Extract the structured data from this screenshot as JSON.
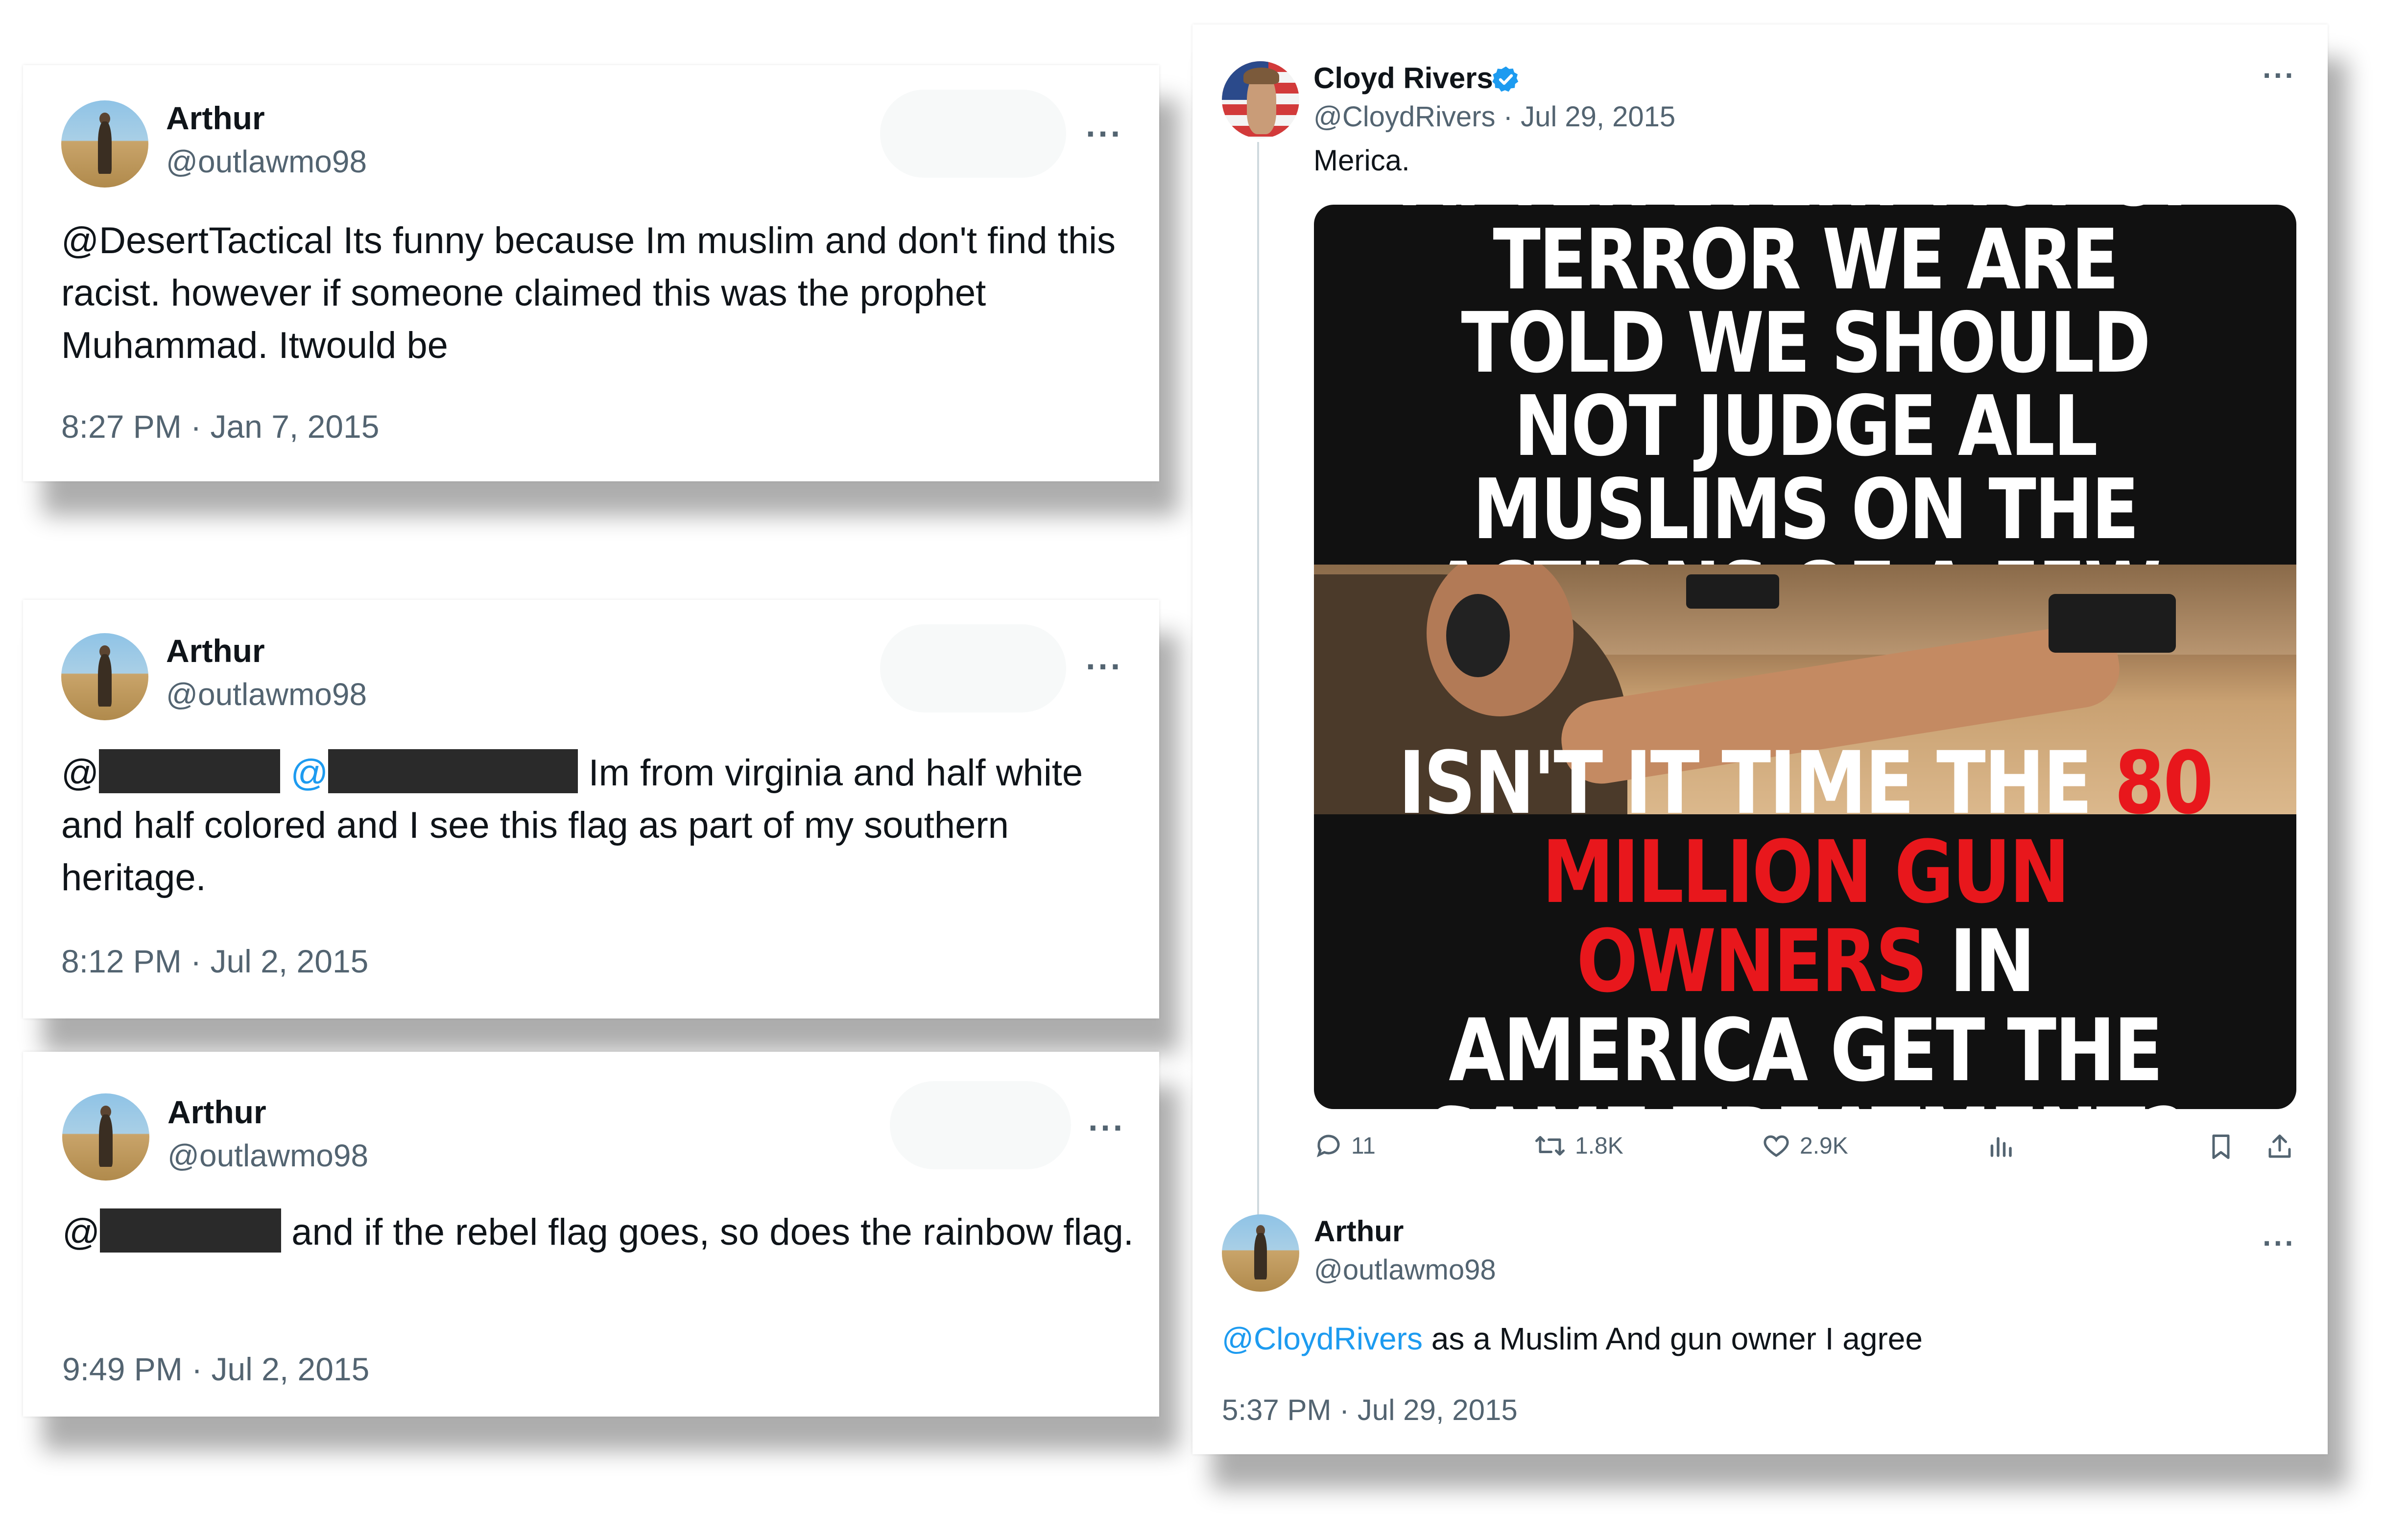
{
  "tweets": [
    {
      "name": "Arthur",
      "handle": "@outlawmo98",
      "text": "@DesertTactical Its funny because Im muslim and don't find this racist. however if someone claimed this was the prophet Muhammad. Itwould be",
      "time": "8:27 PM · Jan 7, 2015"
    },
    {
      "name": "Arthur",
      "handle": "@outlawmo98",
      "at1": "@",
      "at2": "@",
      "text": "Im from virginia and half white and half colored and I see this flag as part of my southern heritage.",
      "time": "8:12 PM · Jul 2, 2015"
    },
    {
      "name": "Arthur",
      "handle": "@outlawmo98",
      "at1": "@",
      "text": "and if the rebel flag goes, so does the rainbow flag.",
      "time": "9:49 PM · Jul 2, 2015"
    }
  ],
  "cloyd": {
    "name": "Cloyd Rivers",
    "handle": "@CloydRivers",
    "date": "· Jul 29, 2015",
    "text": "Merica.",
    "meme_top": "After every act of terror we are told we should not judge all Muslims on the actions of a few.",
    "meme_bottom_1": "Isn't it time the",
    "meme_bottom_red_1": "80 million",
    "meme_bottom_red_2": "gun owners",
    "meme_bottom_2": "in America get the same treatment?",
    "replies": "11",
    "retweets": "1.8K",
    "likes": "2.9K"
  },
  "reply": {
    "name": "Arthur",
    "handle": "@outlawmo98",
    "mention": "@CloydRivers",
    "text": "as a Muslim And gun owner I agree",
    "time": "5:37 PM · Jul 29, 2015"
  },
  "more_label": "···",
  "icons": {
    "verified": "verified-badge-icon",
    "reply": "reply-icon",
    "retweet": "retweet-icon",
    "like": "heart-icon",
    "views": "views-chart-icon",
    "bookmark": "bookmark-icon",
    "share": "share-icon"
  },
  "colors": {
    "link": "#1d9bf0",
    "secondary_text": "#536471",
    "meme_red": "#e8171c",
    "verified": "#1d9bf0"
  }
}
